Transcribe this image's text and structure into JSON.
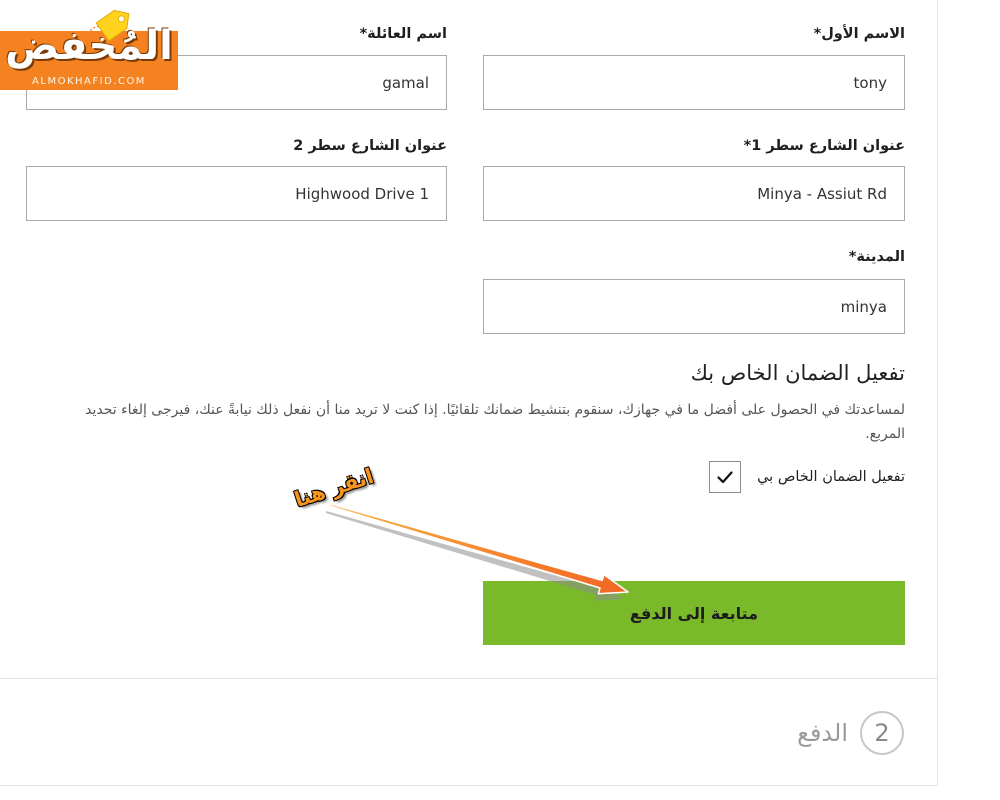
{
  "logo": {
    "wordmark": "المُخفض",
    "domain": "ALMOKHAFID.COM"
  },
  "form": {
    "first_name": {
      "label": "الاسم الأول*",
      "value": "tony"
    },
    "last_name": {
      "label": "اسم العائلة*",
      "value": "gamal"
    },
    "street_line_1": {
      "label": "عنوان الشارع سطر 1*",
      "value": "Minya - Assiut Rd"
    },
    "street_line_2": {
      "label": "عنوان الشارع سطر 2",
      "value": "Highwood Drive 1"
    },
    "city": {
      "label": "المدينة*",
      "value": "minya"
    }
  },
  "warranty": {
    "heading": "تفعيل الضمان الخاص بك",
    "description": "لمساعدتك في الحصول على أفضل ما في جهازك، سنقوم بتنشيط ضمانك تلقائيًا. إذا كنت لا تريد منا أن نفعل ذلك نيابةً عنك، فيرجى إلغاء تحديد المربع.",
    "checkbox_label": "تفعيل الضمان الخاص بي",
    "checked": true
  },
  "continue_button": {
    "label": "متابعة إلى الدفع"
  },
  "annotation": {
    "text": "انقر هنا"
  },
  "next_step": {
    "number": "2",
    "title": "الدفع"
  },
  "colors": {
    "button_green": "#7ab929",
    "logo_orange": "#f58220",
    "annotation_orange": "#f7941d",
    "input_border": "#a9a9a9",
    "muted_text": "#9a9a9a"
  },
  "icons": {
    "checkbox_mark": "check-icon",
    "logo_tag": "price-tag-icon",
    "annotation_arrow": "arrow-icon"
  }
}
